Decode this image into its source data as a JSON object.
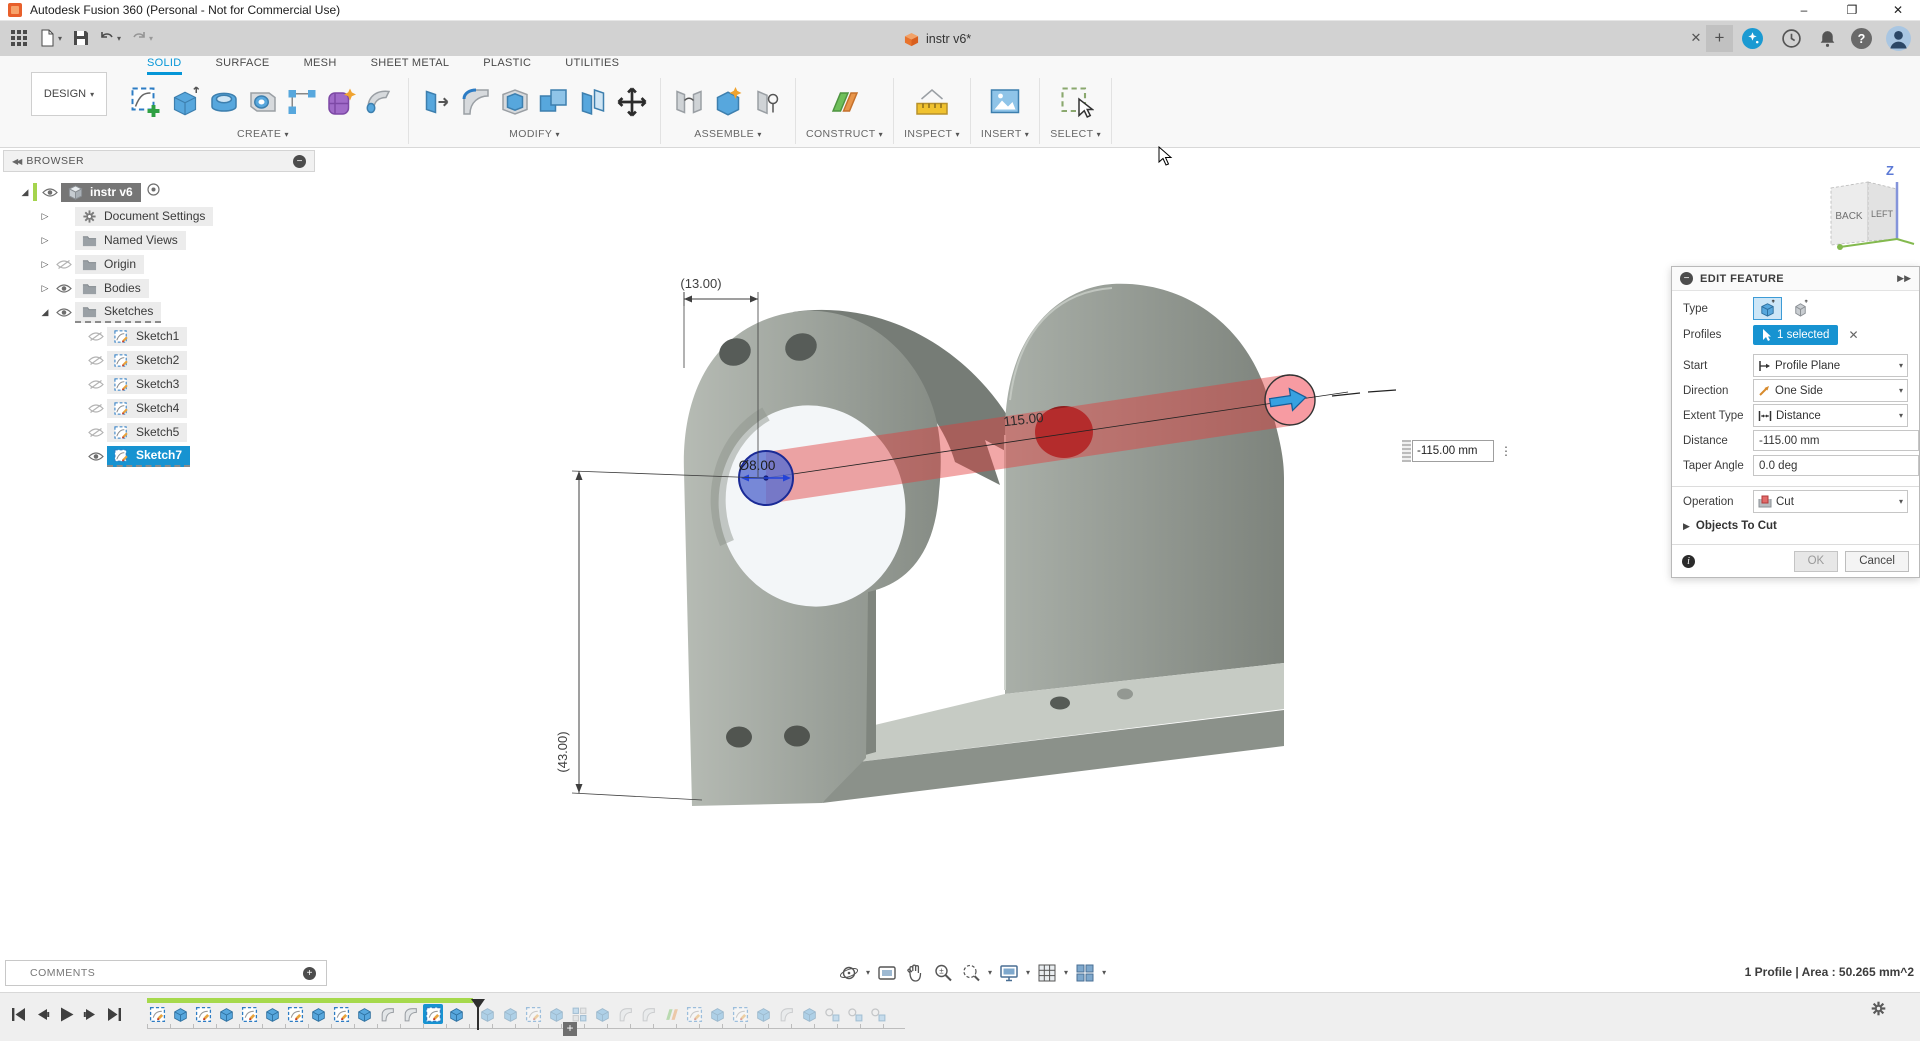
{
  "window": {
    "title": "Autodesk Fusion 360 (Personal - Not for Commercial Use)",
    "controls": [
      "minimize",
      "restore",
      "close"
    ]
  },
  "tabbar": {
    "document_tab": "instr v6*",
    "actions": [
      "close-tab",
      "new-tab",
      "extensions",
      "job-status",
      "notifications",
      "help",
      "profile"
    ]
  },
  "ribbon": {
    "workspace": "DESIGN",
    "active_tab": "SOLID",
    "tabs": [
      "SOLID",
      "SURFACE",
      "MESH",
      "SHEET METAL",
      "PLASTIC",
      "UTILITIES"
    ],
    "groups": [
      {
        "label": "CREATE",
        "icons": [
          "create-sketch",
          "extrude",
          "revolve",
          "hole",
          "pattern",
          "form",
          "sweep"
        ]
      },
      {
        "label": "MODIFY",
        "icons": [
          "press-pull",
          "fillet",
          "shell",
          "combine",
          "offset-face",
          "move"
        ]
      },
      {
        "label": "ASSEMBLE",
        "icons": [
          "joint",
          "new-component",
          "joint-origin"
        ]
      },
      {
        "label": "CONSTRUCT",
        "icons": [
          "construction-plane"
        ]
      },
      {
        "label": "INSPECT",
        "icons": [
          "measure"
        ]
      },
      {
        "label": "INSERT",
        "icons": [
          "canvas"
        ]
      },
      {
        "label": "SELECT",
        "icons": [
          "select-window"
        ]
      }
    ]
  },
  "browser": {
    "title": "BROWSER",
    "rows": [
      {
        "label": "instr v6",
        "icon": "cube",
        "expand": "open",
        "eye": true,
        "chip": "dark",
        "radio": true,
        "indent": 0
      },
      {
        "label": "Document Settings",
        "icon": "gear",
        "expand": "closed",
        "eye": null,
        "chip": null,
        "radio": false,
        "indent": 1
      },
      {
        "label": "Named Views",
        "icon": "folder",
        "expand": "closed",
        "eye": null,
        "chip": null,
        "radio": false,
        "indent": 1
      },
      {
        "label": "Origin",
        "icon": "folder",
        "expand": "closed",
        "eye": false,
        "chip": null,
        "radio": false,
        "indent": 1
      },
      {
        "label": "Bodies",
        "icon": "folder",
        "expand": "closed",
        "eye": true,
        "chip": null,
        "radio": false,
        "indent": 1
      },
      {
        "label": "Sketches",
        "icon": "folder",
        "expand": "open",
        "eye": true,
        "chip": null,
        "radio": false,
        "indent": 1,
        "editing": true
      },
      {
        "label": "Sketch1",
        "icon": "sketch",
        "expand": null,
        "eye": false,
        "chip": null,
        "radio": false,
        "indent": 2
      },
      {
        "label": "Sketch2",
        "icon": "sketch",
        "expand": null,
        "eye": false,
        "chip": null,
        "radio": false,
        "indent": 2
      },
      {
        "label": "Sketch3",
        "icon": "sketch",
        "expand": null,
        "eye": false,
        "chip": null,
        "radio": false,
        "indent": 2
      },
      {
        "label": "Sketch4",
        "icon": "sketch",
        "expand": null,
        "eye": false,
        "chip": null,
        "radio": false,
        "indent": 2
      },
      {
        "label": "Sketch5",
        "icon": "sketch",
        "expand": null,
        "eye": false,
        "chip": null,
        "radio": false,
        "indent": 2
      },
      {
        "label": "Sketch7",
        "icon": "sketch",
        "expand": null,
        "eye": true,
        "chip": "selected",
        "radio": false,
        "indent": 2,
        "editing": true
      }
    ]
  },
  "dialog": {
    "title": "EDIT FEATURE",
    "type_label": "Type",
    "profiles_label": "Profiles",
    "profiles_value": "1 selected",
    "start_label": "Start",
    "start_value": "Profile Plane",
    "direction_label": "Direction",
    "direction_value": "One Side",
    "extent_label": "Extent Type",
    "extent_value": "Distance",
    "distance_label": "Distance",
    "distance_value": "-115.00 mm",
    "taper_label": "Taper Angle",
    "taper_value": "0.0 deg",
    "operation_label": "Operation",
    "operation_value": "Cut",
    "objects_label": "Objects To Cut",
    "ok_label": "OK",
    "cancel_label": "Cancel"
  },
  "viewport": {
    "dim_width": "(13.00)",
    "dim_height": "(43.00)",
    "dim_length": "115.00",
    "dim_diameter": "Ø8.00",
    "distance_input": "-115.00 mm",
    "viewcube": {
      "face_back": "BACK",
      "face_left": "LEFT",
      "axis_z": "Z"
    }
  },
  "statusbar": {
    "comments_label": "COMMENTS",
    "selection_info": "1 Profile | Area : 50.265 mm^2"
  },
  "timeline": {
    "items": [
      {
        "type": "sketch"
      },
      {
        "type": "extrude"
      },
      {
        "type": "sketch"
      },
      {
        "type": "extrude"
      },
      {
        "type": "sketch"
      },
      {
        "type": "extrude"
      },
      {
        "type": "sketch"
      },
      {
        "type": "extrude"
      },
      {
        "type": "sketch"
      },
      {
        "type": "extrude"
      },
      {
        "type": "fillet"
      },
      {
        "type": "fillet"
      },
      {
        "type": "sketch",
        "state": "editing"
      },
      {
        "type": "extrude"
      },
      {
        "type": "marker"
      },
      {
        "type": "extrude",
        "state": "future"
      },
      {
        "type": "extrude",
        "state": "future"
      },
      {
        "type": "sketch",
        "state": "future"
      },
      {
        "type": "extrude",
        "state": "future"
      },
      {
        "type": "pattern",
        "state": "future"
      },
      {
        "type": "extrude",
        "state": "future"
      },
      {
        "type": "fillet",
        "state": "future"
      },
      {
        "type": "fillet",
        "state": "future"
      },
      {
        "type": "mirror",
        "state": "future"
      },
      {
        "type": "sketch",
        "state": "future"
      },
      {
        "type": "extrude",
        "state": "future"
      },
      {
        "type": "sketch",
        "state": "future"
      },
      {
        "type": "extrude",
        "state": "future"
      },
      {
        "type": "fillet",
        "state": "future"
      },
      {
        "type": "extrude",
        "state": "future"
      },
      {
        "type": "joint",
        "state": "future"
      },
      {
        "type": "joint",
        "state": "future"
      },
      {
        "type": "joint",
        "state": "future"
      }
    ],
    "playback": [
      "go-to-start",
      "step-back",
      "play",
      "step-forward",
      "go-to-end"
    ]
  },
  "colors": {
    "accent_blue": "#0696d7",
    "selection_blue": "#1793d1",
    "preview_red": "#e23c3c",
    "profile_blue": "#5b6fd0",
    "progress_green": "#a6d94c"
  }
}
